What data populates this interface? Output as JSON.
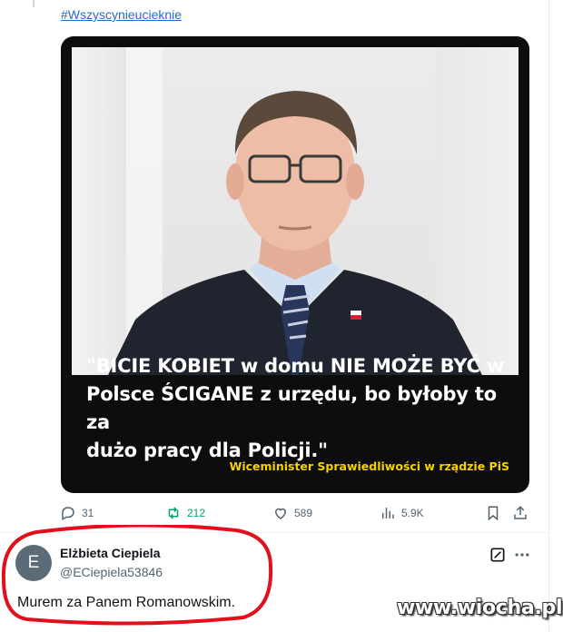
{
  "post": {
    "hashtag": "#Wszyscynieucieknie",
    "image": {
      "quote_line1": "\"BICIE KOBIET w domu NIE MOŻE BYĆ w",
      "quote_line2": "Polsce ŚCIGANE z urzędu, bo byłoby to za",
      "quote_line3": "dużo pracy dla Policji.\"",
      "attribution": "Wiceminister Sprawiedliwości w rządzie PiS"
    },
    "metrics": {
      "replies": "31",
      "reposts": "212",
      "likes": "589",
      "views": "5.9K"
    }
  },
  "reply": {
    "avatar_letter": "E",
    "display_name": "Elżbieta Ciepiela",
    "handle": "@ECiepiela53846",
    "text": "Murem za Panem Romanowskim."
  },
  "watermark": "www.wiocha.pl",
  "colors": {
    "link": "#1d70c9",
    "retweet": "#00a36c",
    "attribution": "#f5d300",
    "annotation": "#e0101c"
  }
}
